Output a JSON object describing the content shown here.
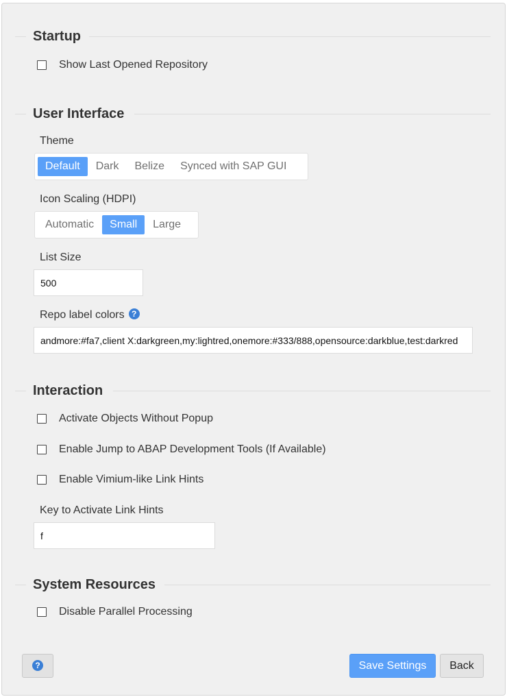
{
  "sections": {
    "startup": {
      "title": "Startup",
      "show_last_repo": "Show Last Opened Repository"
    },
    "ui": {
      "title": "User Interface",
      "theme_label": "Theme",
      "theme_options": [
        "Default",
        "Dark",
        "Belize",
        "Synced with SAP GUI"
      ],
      "theme_selected": "Default",
      "icon_scaling_label": "Icon Scaling (HDPI)",
      "icon_scaling_options": [
        "Automatic",
        "Small",
        "Large"
      ],
      "icon_scaling_selected": "Small",
      "list_size_label": "List Size",
      "list_size_value": "500",
      "repo_label_colors_label": "Repo label colors",
      "repo_label_colors_value": "andmore:#fa7,client X:darkgreen,my:lightred,onemore:#333/888,opensource:darkblue,test:darkred"
    },
    "interaction": {
      "title": "Interaction",
      "activate_objects": "Activate Objects Without Popup",
      "enable_jump": "Enable Jump to ABAP Development Tools (If Available)",
      "enable_vimium": "Enable Vimium-like Link Hints",
      "link_hint_key_label": "Key to Activate Link Hints",
      "link_hint_key_value": "f"
    },
    "system": {
      "title": "System Resources",
      "disable_parallel": "Disable Parallel Processing"
    }
  },
  "buttons": {
    "help_icon": "?",
    "save": "Save Settings",
    "back": "Back"
  },
  "colors": {
    "accent": "#5aa0f8",
    "help_badge": "#3a7fd6",
    "panel_bg": "#f0f0f0"
  }
}
